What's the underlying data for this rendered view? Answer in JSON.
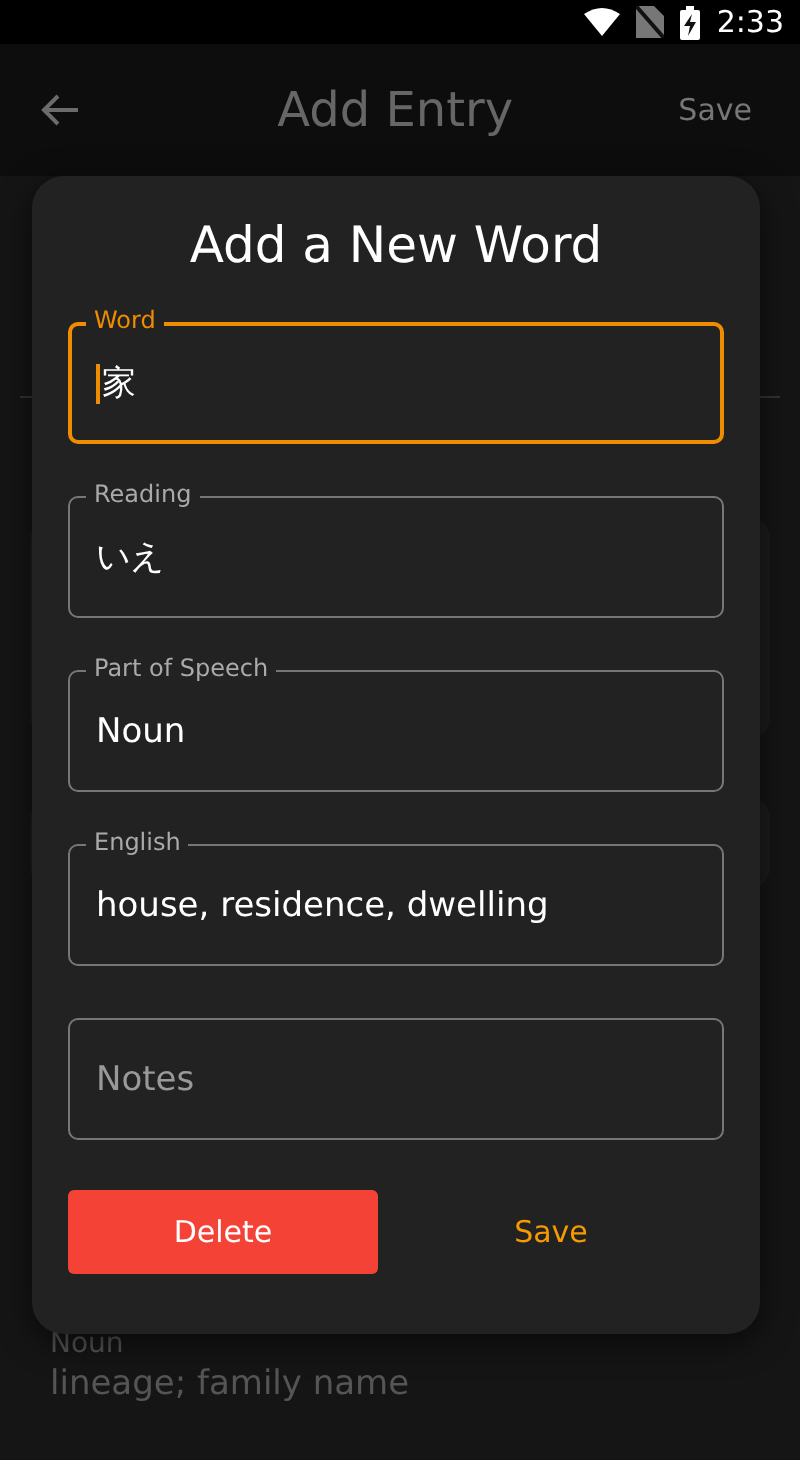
{
  "status_bar": {
    "time": "2:33"
  },
  "app_bar": {
    "title": "Add Entry",
    "action": "Save"
  },
  "background_entry": {
    "part_of_speech": "Noun",
    "meaning": "lineage; family name"
  },
  "dialog": {
    "title": "Add a New Word",
    "fields": [
      {
        "label": "Word",
        "value": "家",
        "focused": true
      },
      {
        "label": "Reading",
        "value": "いえ",
        "focused": false
      },
      {
        "label": "Part of Speech",
        "value": "Noun",
        "focused": false
      },
      {
        "label": "English",
        "value": "house, residence, dwelling",
        "focused": false
      },
      {
        "placeholder": "Notes",
        "focused": false
      }
    ],
    "buttons": [
      {
        "label": "Delete",
        "kind": "danger"
      },
      {
        "label": "Save",
        "kind": "text"
      }
    ]
  }
}
